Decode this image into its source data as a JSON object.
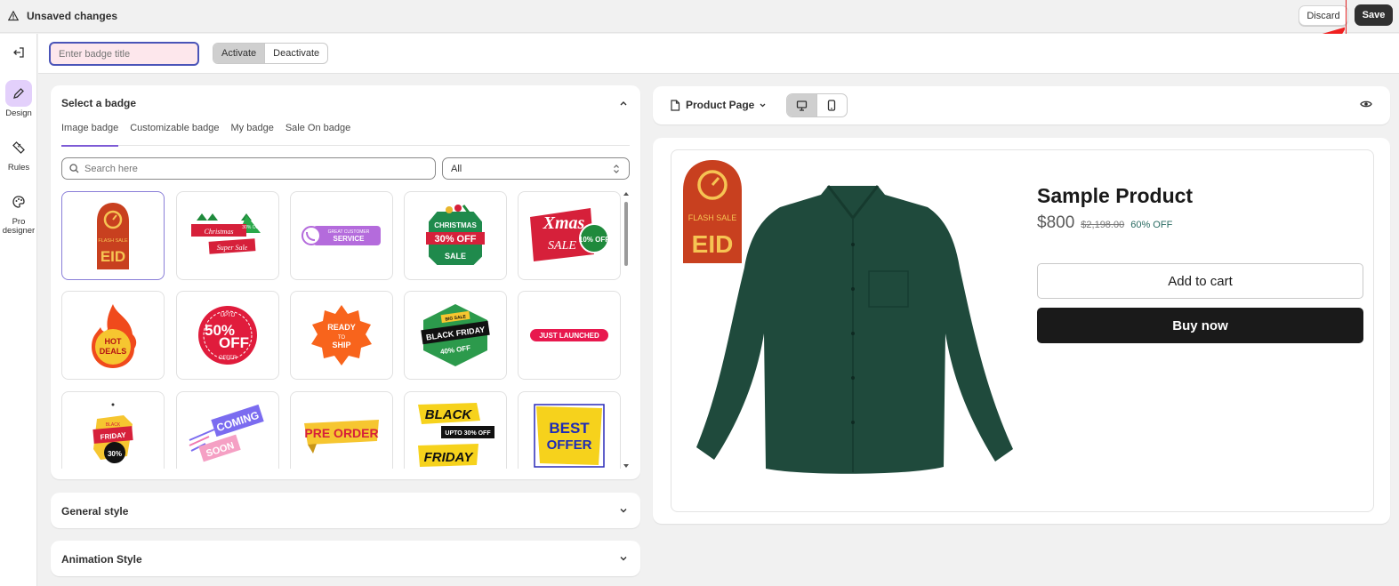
{
  "topbar": {
    "title": "Unsaved changes",
    "discard_label": "Discard",
    "save_label": "Save"
  },
  "rail": {
    "items": [
      {
        "label": "",
        "icon": "exit-icon"
      },
      {
        "label": "Design",
        "icon": "pencil-icon",
        "active": true
      },
      {
        "label": "Rules",
        "icon": "ruler-icon"
      },
      {
        "label": "Pro designer",
        "icon": "palette-icon"
      }
    ]
  },
  "subbar": {
    "title_placeholder": "Enter badge title",
    "title_value": "",
    "activate_label": "Activate",
    "deactivate_label": "Deactivate"
  },
  "select_badge": {
    "title": "Select a badge",
    "tabs": [
      "Image badge",
      "Customizable badge",
      "My badge",
      "Sale On badge"
    ],
    "active_tab": 0,
    "search_placeholder": "Search here",
    "filter_value": "All",
    "badges": [
      {
        "name": "flash-sale-eid",
        "lines": [
          "FLASH SALE",
          "EID"
        ]
      },
      {
        "name": "christmas-super-sale",
        "lines": [
          "Christmas",
          "Super Sale",
          "30% OFF"
        ]
      },
      {
        "name": "great-customer-service",
        "lines": [
          "GREAT CUSTOMER",
          "SERVICE"
        ]
      },
      {
        "name": "christmas-30-off",
        "lines": [
          "CHRISTMAS",
          "30% OFF",
          "SALE"
        ]
      },
      {
        "name": "xmas-sale",
        "lines": [
          "Xmas",
          "SALE",
          "10% OFF"
        ]
      },
      {
        "name": "hot-deals",
        "lines": [
          "HOT",
          "DEALS"
        ]
      },
      {
        "name": "upto-50-off",
        "lines": [
          "UPTO",
          "50%",
          "OFF",
          "OFFER"
        ]
      },
      {
        "name": "ready-to-ship",
        "lines": [
          "READY",
          "TO",
          "SHIP"
        ]
      },
      {
        "name": "black-friday-40-off",
        "lines": [
          "BIG SALE",
          "BLACK FRIDAY",
          "40% OFF"
        ]
      },
      {
        "name": "just-launched",
        "lines": [
          "JUST LAUNCHED"
        ]
      },
      {
        "name": "black-friday-30",
        "lines": [
          "BLACK",
          "FRIDAY",
          "30%"
        ]
      },
      {
        "name": "coming-soon",
        "lines": [
          "COMING",
          "SOON"
        ]
      },
      {
        "name": "pre-order",
        "lines": [
          "PRE ORDER"
        ]
      },
      {
        "name": "black-friday-upto-30",
        "lines": [
          "BLACK",
          "UPTO 30% OFF",
          "FRIDAY"
        ]
      },
      {
        "name": "best-offer",
        "lines": [
          "BEST",
          "OFFER"
        ]
      }
    ]
  },
  "general_style": {
    "title": "General style"
  },
  "animation_style": {
    "title": "Animation Style"
  },
  "preview": {
    "page_label": "Product Page",
    "device": "desktop",
    "product": {
      "title": "Sample Product",
      "price": "$800",
      "compare_price": "$2,198.00",
      "discount": "60% OFF",
      "add_to_cart": "Add to cart",
      "buy_now": "Buy now"
    },
    "badge_lines": [
      "FLASH SALE",
      "EID"
    ]
  },
  "colors": {
    "accent": "#7d5bd6",
    "primary_button": "#303030",
    "annotation": "#e02020",
    "shirt": "#1f4a3c"
  }
}
